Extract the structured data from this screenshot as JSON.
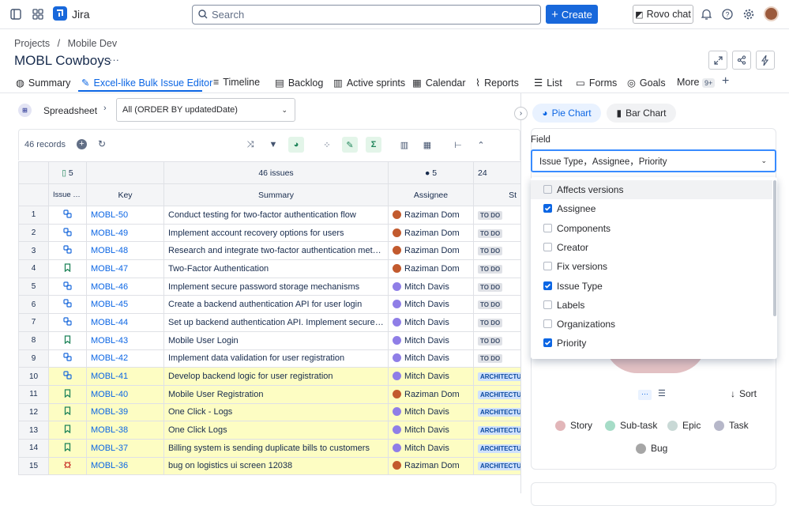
{
  "app": {
    "name": "Jira"
  },
  "search": {
    "placeholder": "Search"
  },
  "actions": {
    "create": "Create",
    "rovo": "Rovo chat"
  },
  "breadcrumb": {
    "projects": "Projects",
    "separator": "/",
    "project": "Mobile Dev"
  },
  "page": {
    "title": "MOBL Cowboys",
    "more": "···"
  },
  "tabs": [
    {
      "label": "Summary"
    },
    {
      "label": "Excel-like Bulk Issue Editor"
    },
    {
      "label": "Timeline"
    },
    {
      "label": "Backlog"
    },
    {
      "label": "Active sprints"
    },
    {
      "label": "Calendar"
    },
    {
      "label": "Reports"
    },
    {
      "label": "List"
    },
    {
      "label": "Forms"
    },
    {
      "label": "Goals"
    },
    {
      "label": "More"
    }
  ],
  "more_badge": "9+",
  "editor": {
    "view": "Spreadsheet",
    "jql": "All (ORDER BY updatedDate)",
    "records": "46 records"
  },
  "grid": {
    "group_counts": {
      "type": "5",
      "summary": "46 issues",
      "assignee": "5",
      "status": "24"
    },
    "headers": {
      "type": "Issue Type",
      "key": "Key",
      "summary": "Summary",
      "assignee": "Assignee",
      "status": "St"
    },
    "rows": [
      {
        "n": "1",
        "key": "MOBL-50",
        "summary": "Conduct testing for two-factor authentication flow",
        "assignee": "Raziman Dom",
        "status": "TO DO",
        "type": "subtask"
      },
      {
        "n": "2",
        "key": "MOBL-49",
        "summary": "Implement account recovery options for users",
        "assignee": "Raziman Dom",
        "status": "TO DO",
        "type": "subtask"
      },
      {
        "n": "3",
        "key": "MOBL-48",
        "summary": "Research and integrate two-factor authentication methods",
        "assignee": "Raziman Dom",
        "status": "TO DO",
        "type": "subtask"
      },
      {
        "n": "4",
        "key": "MOBL-47",
        "summary": "Two-Factor Authentication",
        "assignee": "Raziman Dom",
        "status": "TO DO",
        "type": "story"
      },
      {
        "n": "5",
        "key": "MOBL-46",
        "summary": "Implement secure password storage mechanisms",
        "assignee": "Mitch Davis",
        "status": "TO DO",
        "type": "subtask"
      },
      {
        "n": "6",
        "key": "MOBL-45",
        "summary": "Create a backend authentication API for user login",
        "assignee": "Mitch Davis",
        "status": "TO DO",
        "type": "subtask"
      },
      {
        "n": "7",
        "key": "MOBL-44",
        "summary": "Set up backend authentication API. Implement secure pass...",
        "assignee": "Mitch Davis",
        "status": "TO DO",
        "type": "subtask"
      },
      {
        "n": "8",
        "key": "MOBL-43",
        "summary": "Mobile User Login",
        "assignee": "Mitch Davis",
        "status": "TO DO",
        "type": "story"
      },
      {
        "n": "9",
        "key": "MOBL-42",
        "summary": "Implement data validation for user registration",
        "assignee": "Mitch Davis",
        "status": "TO DO",
        "type": "subtask"
      },
      {
        "n": "10",
        "key": "MOBL-41",
        "summary": "Develop backend logic for user registration",
        "assignee": "Mitch Davis",
        "status": "ARCHITECTU",
        "type": "subtask"
      },
      {
        "n": "11",
        "key": "MOBL-40",
        "summary": "Mobile User Registration",
        "assignee": "Raziman Dom",
        "status": "ARCHITECTU",
        "type": "story"
      },
      {
        "n": "12",
        "key": "MOBL-39",
        "summary": "One Click - Logs",
        "assignee": "Mitch Davis",
        "status": "ARCHITECTU",
        "type": "story"
      },
      {
        "n": "13",
        "key": "MOBL-38",
        "summary": "One Click Logs",
        "assignee": "Mitch Davis",
        "status": "ARCHITECTU",
        "type": "story"
      },
      {
        "n": "14",
        "key": "MOBL-37",
        "summary": "Billing system is sending duplicate bills to customers",
        "assignee": "Mitch Davis",
        "status": "ARCHITECTU",
        "type": "story"
      },
      {
        "n": "15",
        "key": "MOBL-36",
        "summary": "bug on logistics ui screen 12038",
        "assignee": "Raziman Dom",
        "status": "ARCHITECTU",
        "type": "bug"
      }
    ]
  },
  "panel": {
    "pie_tab": "Pie Chart",
    "bar_tab": "Bar Chart",
    "field_label": "Field",
    "field_value": "Issue Type，Assignee，Priority",
    "options": [
      {
        "label": "Affects versions",
        "checked": false
      },
      {
        "label": "Assignee",
        "checked": true
      },
      {
        "label": "Components",
        "checked": false
      },
      {
        "label": "Creator",
        "checked": false
      },
      {
        "label": "Fix versions",
        "checked": false
      },
      {
        "label": "Issue Type",
        "checked": true
      },
      {
        "label": "Labels",
        "checked": false
      },
      {
        "label": "Organizations",
        "checked": false
      },
      {
        "label": "Priority",
        "checked": true
      }
    ],
    "sort": "Sort",
    "legend": [
      {
        "label": "Story",
        "color": "#e2b6b9"
      },
      {
        "label": "Sub-task",
        "color": "#a6dcc7"
      },
      {
        "label": "Epic",
        "color": "#c9d9d6"
      },
      {
        "label": "Task",
        "color": "#b6b7c9"
      },
      {
        "label": "Bug",
        "color": "#a6a6a6"
      }
    ]
  }
}
